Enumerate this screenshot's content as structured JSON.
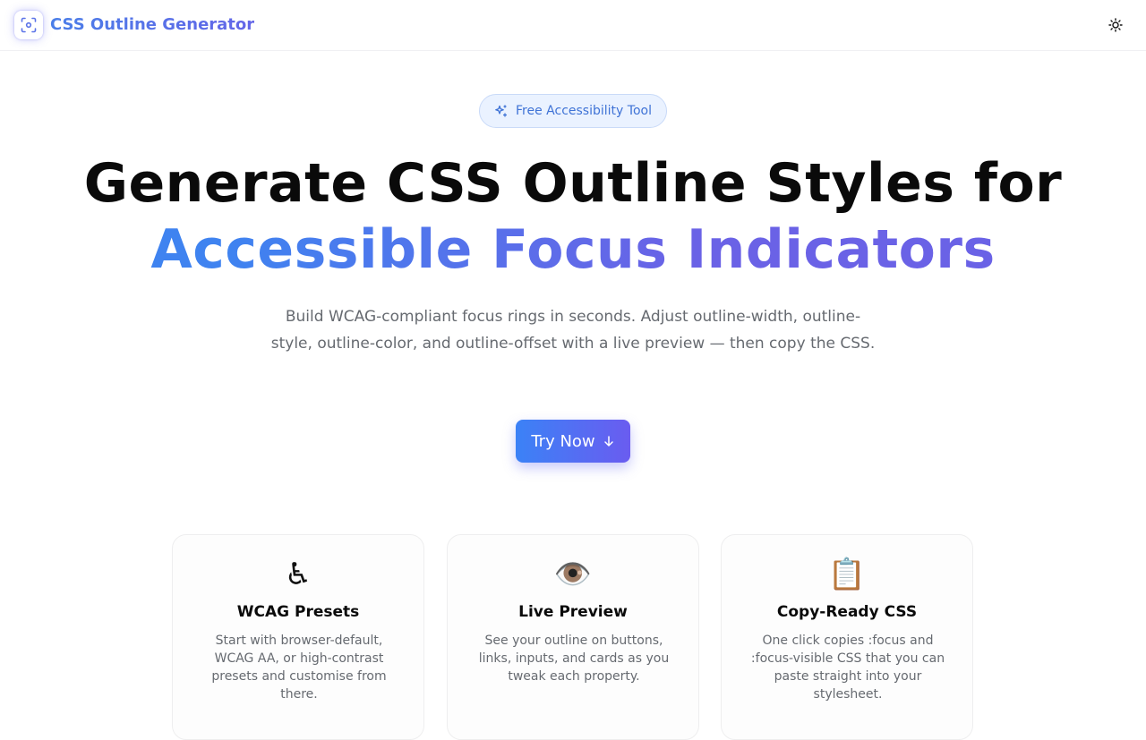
{
  "header": {
    "logo_icon": "focus-frame-icon",
    "brand": "CSS Outline Generator",
    "theme_icon": "sun-icon"
  },
  "hero": {
    "badge_icon": "sparkles-icon",
    "badge": "Free Accessibility Tool",
    "title_line1": "Generate CSS Outline Styles for",
    "title_line2": "Accessible Focus Indicators",
    "subtitle": "Build WCAG-compliant focus rings in seconds. Adjust outline-width, outline-style, outline-color, and outline-offset with a live preview — then copy the CSS.",
    "cta_label": "Try Now",
    "cta_icon": "arrow-down-icon"
  },
  "features": [
    {
      "icon": "♿",
      "icon_name": "wheelchair-icon",
      "title": "WCAG Presets",
      "text": "Start with browser-default, WCAG AA, or high-contrast presets and customise from there."
    },
    {
      "icon": "👁️",
      "icon_name": "eye-icon",
      "title": "Live Preview",
      "text": "See your outline on buttons, links, inputs, and cards as you tweak each property."
    },
    {
      "icon": "📋",
      "icon_name": "clipboard-icon",
      "title": "Copy-Ready CSS",
      "text": "One click copies :focus and :focus-visible CSS that you can paste straight into your stylesheet."
    }
  ],
  "colors": {
    "brand_start": "#4a7ee8",
    "brand_end": "#6466e8",
    "cta_start": "#3b82f6",
    "cta_end": "#6a5cf0"
  }
}
